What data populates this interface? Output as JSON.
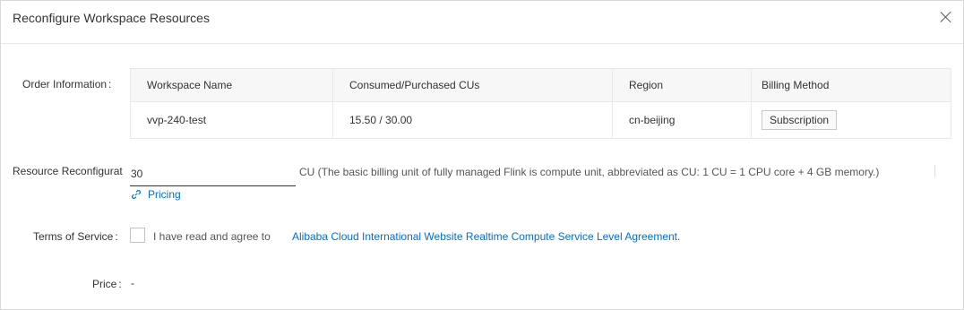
{
  "dialog": {
    "title": "Reconfigure Workspace Resources"
  },
  "order": {
    "label": "Order Information",
    "colon": ":",
    "columns": [
      "Workspace Name",
      "Consumed/Purchased CUs",
      "Region",
      "Billing Method"
    ],
    "row": {
      "workspace_name": "vvp-240-test",
      "cus": "15.50 / 30.00",
      "region": "cn-beijing",
      "billing_method": "Subscription"
    }
  },
  "resource": {
    "label": "Resource Reconfigurat",
    "value": "30",
    "unit_note": "CU (The basic billing unit of fully managed Flink is compute unit, abbreviated as CU: 1 CU = 1 CPU core + 4 GB memory.)",
    "pricing_link": "Pricing"
  },
  "terms": {
    "label": "Terms of Service",
    "colon": ":",
    "checked": false,
    "agree_text": "I have read and agree to",
    "link_text": "Alibaba Cloud International Website Realtime Compute Service Level Agreement."
  },
  "price": {
    "label": "Price",
    "colon": ":",
    "value": "-"
  },
  "colors": {
    "link": "#0070cc",
    "border": "#e8e8e8",
    "header_bg": "#f7f7f7"
  },
  "icons": {
    "close": "close-icon",
    "pricing": "link-icon"
  }
}
